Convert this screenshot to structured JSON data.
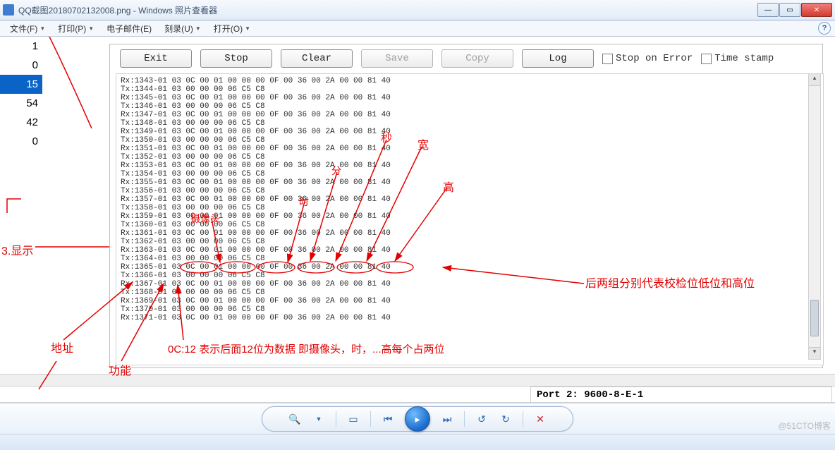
{
  "window": {
    "title": "QQ截图20180702132008.png - Windows 照片查看器"
  },
  "menu": {
    "file": "文件(F)",
    "print": "打印(P)",
    "email": "电子邮件(E)",
    "burn": "刻录(U)",
    "open": "打开(O)"
  },
  "left_values": [
    "1",
    "0",
    "15",
    "54",
    "42",
    "0"
  ],
  "toolbar": {
    "exit": "Exit",
    "stop": "Stop",
    "clear": "Clear",
    "save": "Save",
    "copy": "Copy",
    "log": "Log",
    "stop_on_error": "Stop on Error",
    "timestamp": "Time stamp"
  },
  "log_lines": [
    "Rx:1343-01 03 0C 00 01 00 00 00 0F 00 36 00 2A 00 00 81 40",
    "Tx:1344-01 03 00 00 00 06 C5 C8",
    "Rx:1345-01 03 0C 00 01 00 00 00 0F 00 36 00 2A 00 00 81 40",
    "Tx:1346-01 03 00 00 00 06 C5 C8",
    "Rx:1347-01 03 0C 00 01 00 00 00 0F 00 36 00 2A 00 00 81 40",
    "Tx:1348-01 03 00 00 00 06 C5 C8",
    "Rx:1349-01 03 0C 00 01 00 00 00 0F 00 36 00 2A 00 00 81 40",
    "Tx:1350-01 03 00 00 00 06 C5 C8",
    "Rx:1351-01 03 0C 00 01 00 00 00 0F 00 36 00 2A 00 00 81 40",
    "Tx:1352-01 03 00 00 00 06 C5 C8",
    "Rx:1353-01 03 0C 00 01 00 00 00 0F 00 36 00 2A 00 00 81 40",
    "Tx:1354-01 03 00 00 00 06 C5 C8",
    "Rx:1355-01 03 0C 00 01 00 00 00 0F 00 36 00 2A 00 00 81 40",
    "Tx:1356-01 03 00 00 00 06 C5 C8",
    "Rx:1357-01 03 0C 00 01 00 00 00 0F 00 36 00 2A 00 00 81 40",
    "Tx:1358-01 03 00 00 00 06 C5 C8",
    "Rx:1359-01 03 0C 00 01 00 00 00 0F 00 36 00 2A 00 00 81 40",
    "Tx:1360-01 03 00 00 00 06 C5 C8",
    "Rx:1361-01 03 0C 00 01 00 00 00 0F 00 36 00 2A 00 00 81 40",
    "Tx:1362-01 03 00 00 00 06 C5 C8",
    "Rx:1363-01 03 0C 00 01 00 00 00 0F 00 36 00 2A 00 00 81 40",
    "Tx:1364-01 03 00 00 00 06 C5 C8",
    "Rx:1365-01 03 0C 00 01 00 00 00 0F 00 36 00 2A 00 00 81 40",
    "Tx:1366-01 03 00 00 00 06 C5 C8",
    "Rx:1367-01 03 0C 00 01 00 00 00 0F 00 36 00 2A 00 00 81 40",
    "Tx:1368-01 03 00 00 00 06 C5 C8",
    "Rx:1369-01 03 0C 00 01 00 00 00 0F 00 36 00 2A 00 00 81 40",
    "Tx:1370-01 03 00 00 00 06 C5 C8",
    "Rx:1371-01 03 0C 00 01 00 00 00 0F 00 36 00 2A 00 00 81 40"
  ],
  "status": {
    "port": "Port 2: 9600-8-E-1"
  },
  "annotations": {
    "sec": "秒",
    "min": "分",
    "hour": "时",
    "camera": "摄像头",
    "width": "宽",
    "height": "高",
    "display": "3.显示",
    "addr": "地址",
    "func": "功能",
    "note_0c12": "0C:12 表示后面12位为数据 即摄像头，时，...高每个占两位",
    "crc": "后两组分别代表校检位低位和高位"
  },
  "watermark": "@51CTO博客"
}
